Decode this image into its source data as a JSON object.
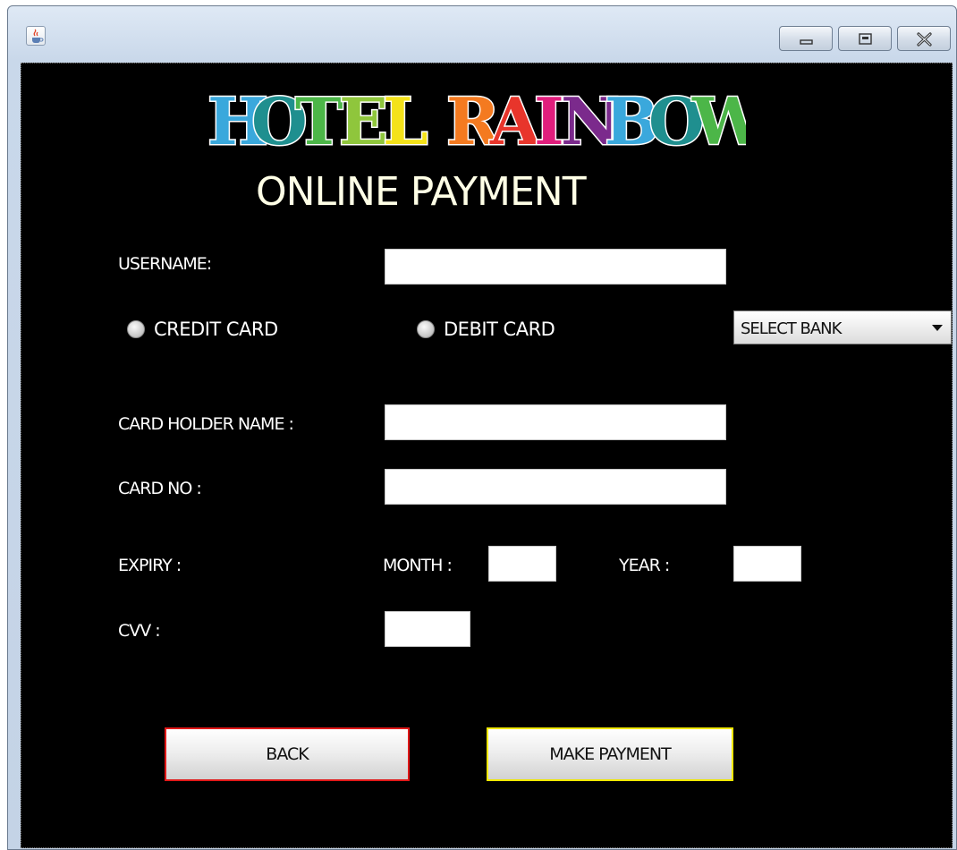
{
  "window": {
    "controls": {
      "minimize_icon": "minimize-icon",
      "maximize_icon": "maximize-icon",
      "close_icon": "close-icon"
    },
    "app_icon": "java-cup-icon"
  },
  "logo": {
    "word1": [
      "H",
      "O",
      "T",
      "E",
      "L"
    ],
    "word2": [
      "R",
      "A",
      "I",
      "N",
      "B",
      "O",
      "W"
    ],
    "colors1": [
      "#3aa8dc",
      "#1f8f8f",
      "#4cb648",
      "#8fc63c",
      "#f4e21a"
    ],
    "colors2": [
      "#f47a20",
      "#e8352b",
      "#e01e7c",
      "#7b2a8c",
      "#3aa8dc",
      "#1f8f8f",
      "#4cb648"
    ]
  },
  "title": "ONLINE PAYMENT",
  "form": {
    "username_label": "USERNAME:",
    "username_value": "",
    "credit_card_label": "CREDIT CARD",
    "debit_card_label": "DEBIT CARD",
    "bank_select": "SELECT BANK",
    "card_holder_label": "CARD HOLDER NAME :",
    "card_holder_value": "",
    "card_no_label": "CARD NO :",
    "card_no_value": "",
    "expiry_label": "EXPIRY  :",
    "month_label": "MONTH :",
    "month_value": "",
    "year_label": "YEAR :",
    "year_value": "",
    "cvv_label": "CVV :",
    "cvv_value": ""
  },
  "buttons": {
    "back": "BACK",
    "make_payment": "MAKE PAYMENT"
  },
  "colors": {
    "background": "#000000",
    "back_border": "#e01818",
    "pay_border": "#f0e800",
    "title_color": "#ffffe6"
  }
}
